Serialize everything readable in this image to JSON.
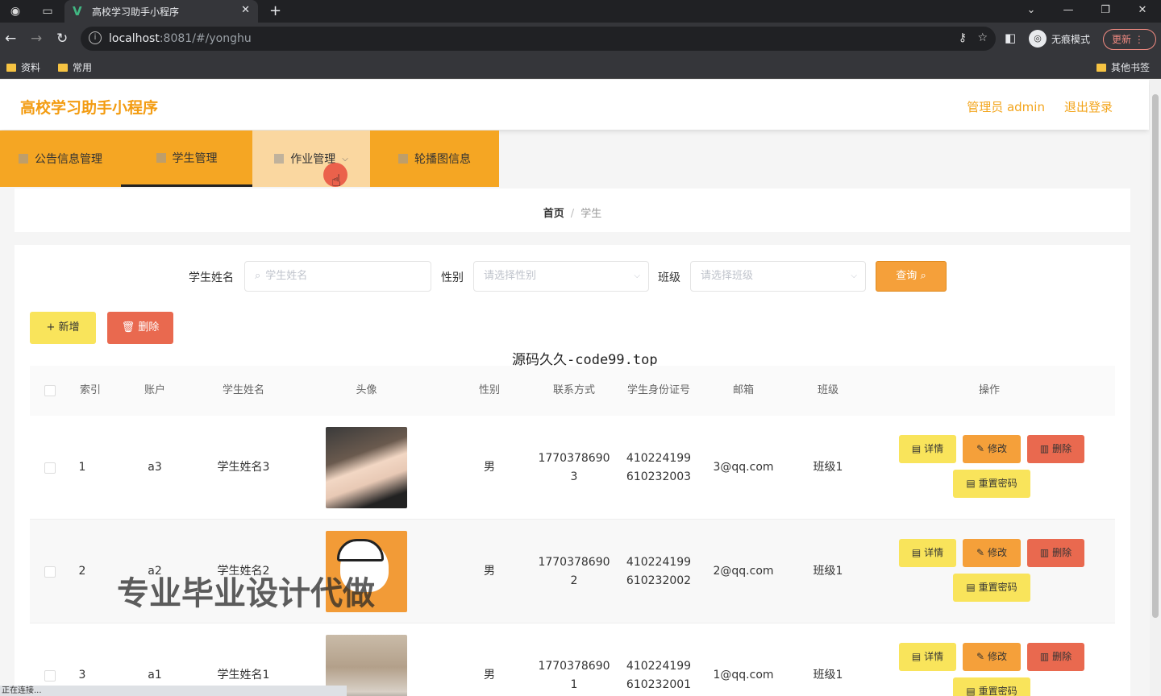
{
  "browser": {
    "tab_title": "高校学习助手小程序",
    "url_host": "localhost",
    "url_rest": ":8081/#/yonghu",
    "incognito_label": "无痕模式",
    "update_label": "更新",
    "bookmarks": [
      "资料",
      "常用"
    ],
    "other_bookmarks": "其他书签",
    "status_text": "正在连接..."
  },
  "header": {
    "brand": "高校学习助手小程序",
    "admin_label": "管理员 admin",
    "logout_label": "退出登录"
  },
  "nav": [
    "公告信息管理",
    "学生管理",
    "作业管理",
    "轮播图信息"
  ],
  "breadcrumb": {
    "home": "首页",
    "separator": "/",
    "current": "学生"
  },
  "search": {
    "name_label": "学生姓名",
    "name_placeholder": "学生姓名",
    "gender_label": "性别",
    "gender_placeholder": "请选择性别",
    "class_label": "班级",
    "class_placeholder": "请选择班级",
    "query_label": "查询"
  },
  "actions": {
    "add_label": "+ 新增",
    "delete_label": "删除"
  },
  "overlay_text": "源码久久-code99.top",
  "table": {
    "headers": [
      "索引",
      "账户",
      "学生姓名",
      "头像",
      "性别",
      "联系方式",
      "学生身份证号",
      "邮箱",
      "班级",
      "操作"
    ],
    "rows": [
      {
        "index": "1",
        "account": "a3",
        "name": "学生姓名3",
        "gender": "男",
        "phone": "17703786903",
        "idcard": "410224199610232003",
        "email": "3@qq.com",
        "class": "班级1"
      },
      {
        "index": "2",
        "account": "a2",
        "name": "学生姓名2",
        "gender": "男",
        "phone": "17703786902",
        "idcard": "410224199610232002",
        "email": "2@qq.com",
        "class": "班级1"
      },
      {
        "index": "3",
        "account": "a1",
        "name": "学生姓名1",
        "gender": "男",
        "phone": "17703786901",
        "idcard": "410224199610232001",
        "email": "1@qq.com",
        "class": "班级1"
      }
    ],
    "op_labels": {
      "detail": "详情",
      "edit": "修改",
      "remove": "删除",
      "reset": "重置密码"
    }
  },
  "watermark_text": "专业毕业设计代做"
}
